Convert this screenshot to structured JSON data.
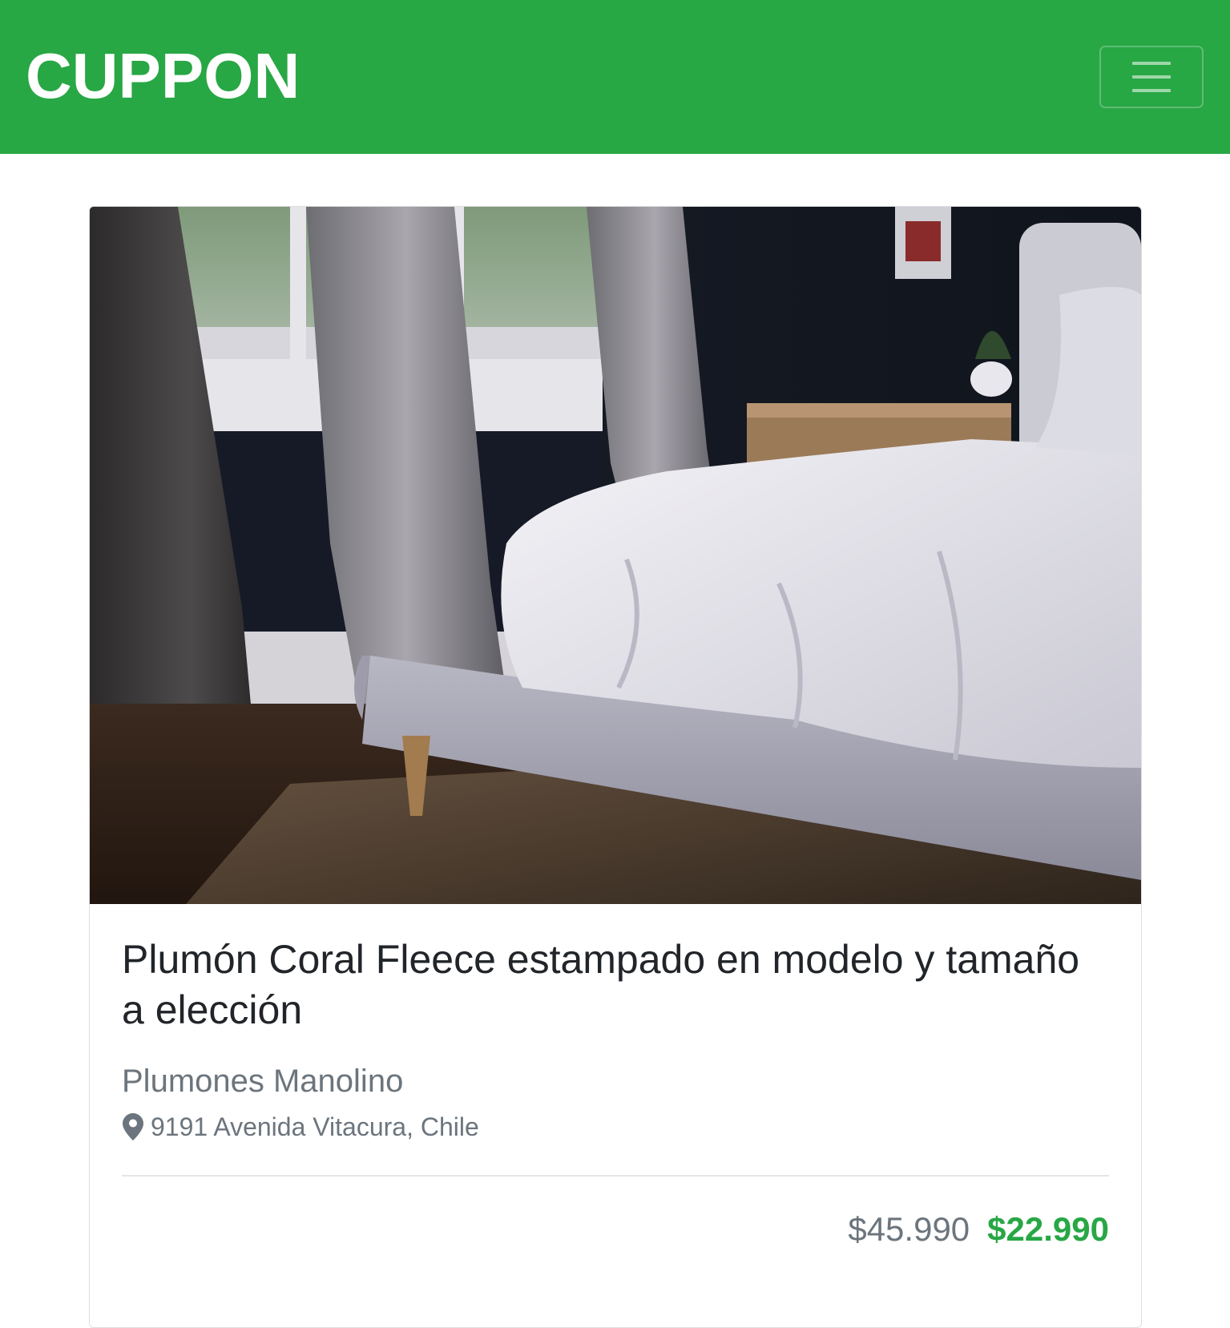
{
  "header": {
    "brand": "CUPPON",
    "menu_icon": "hamburger-menu-icon",
    "background_color": "#28a745"
  },
  "deal": {
    "image_description_icon": "bedroom-photo",
    "title": "Plumón Coral Fleece estampado en modelo y tamaño a elección",
    "merchant": "Plumones Manolino",
    "location_icon": "map-marker-icon",
    "address": "9191 Avenida Vitacura, Chile",
    "original_price": "$45.990",
    "discounted_price": "$22.990",
    "price_color": "#28a745"
  }
}
